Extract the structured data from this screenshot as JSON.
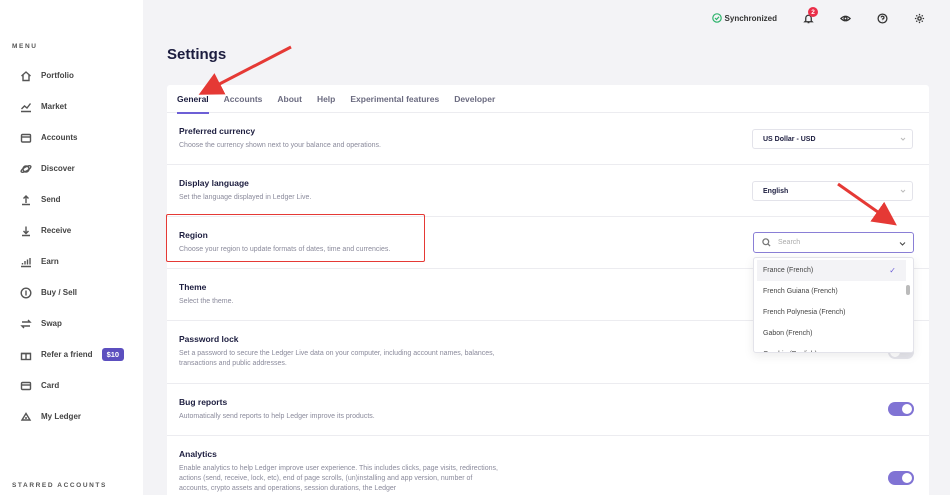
{
  "sidebar": {
    "menu_title": "MENU",
    "items": [
      {
        "label": "Portfolio",
        "icon": "home-icon"
      },
      {
        "label": "Market",
        "icon": "chart-icon"
      },
      {
        "label": "Accounts",
        "icon": "wallet-icon"
      },
      {
        "label": "Discover",
        "icon": "planet-icon"
      },
      {
        "label": "Send",
        "icon": "arrow-up-icon"
      },
      {
        "label": "Receive",
        "icon": "arrow-down-icon"
      },
      {
        "label": "Earn",
        "icon": "growth-icon"
      },
      {
        "label": "Buy / Sell",
        "icon": "coin-icon"
      },
      {
        "label": "Swap",
        "icon": "swap-icon"
      },
      {
        "label": "Refer a friend",
        "icon": "gift-icon",
        "badge": "$10"
      },
      {
        "label": "Card",
        "icon": "card-icon"
      },
      {
        "label": "My Ledger",
        "icon": "ledger-icon"
      }
    ],
    "starred_title": "STARRED ACCOUNTS"
  },
  "topbar": {
    "sync_label": "Synchronized",
    "notification_count": "2"
  },
  "page": {
    "title": "Settings"
  },
  "tabs": [
    "General",
    "Accounts",
    "About",
    "Help",
    "Experimental features",
    "Developer"
  ],
  "settings": {
    "currency": {
      "title": "Preferred currency",
      "desc": "Choose the currency shown next to your balance and operations.",
      "value": "US Dollar - USD"
    },
    "language": {
      "title": "Display language",
      "desc": "Set the language displayed in Ledger Live.",
      "value": "English"
    },
    "region": {
      "title": "Region",
      "desc": "Choose your region to update formats of dates, time and currencies.",
      "placeholder": "Search"
    },
    "theme": {
      "title": "Theme",
      "desc": "Select the theme."
    },
    "password": {
      "title": "Password lock",
      "desc": "Set a password to secure the Ledger Live data on your computer, including account names, balances, transactions and public addresses."
    },
    "bug_reports": {
      "title": "Bug reports",
      "desc": "Automatically send reports to help Ledger improve its products."
    },
    "analytics": {
      "title": "Analytics",
      "desc": "Enable analytics to help Ledger improve user experience. This includes clicks, page visits, redirections, actions (send, receive, lock, etc), end of page scrolls, (un)installing and app version, number of accounts, crypto assets and operations, session durations, the Ledger"
    }
  },
  "region_options": [
    "France (French)",
    "French Guiana (French)",
    "French Polynesia (French)",
    "Gabon (French)",
    "Gambia (English)"
  ],
  "colors": {
    "accent": "#6d5fd6",
    "highlight": "#e53935",
    "success": "#2db36b",
    "notification": "#ea2e49"
  }
}
